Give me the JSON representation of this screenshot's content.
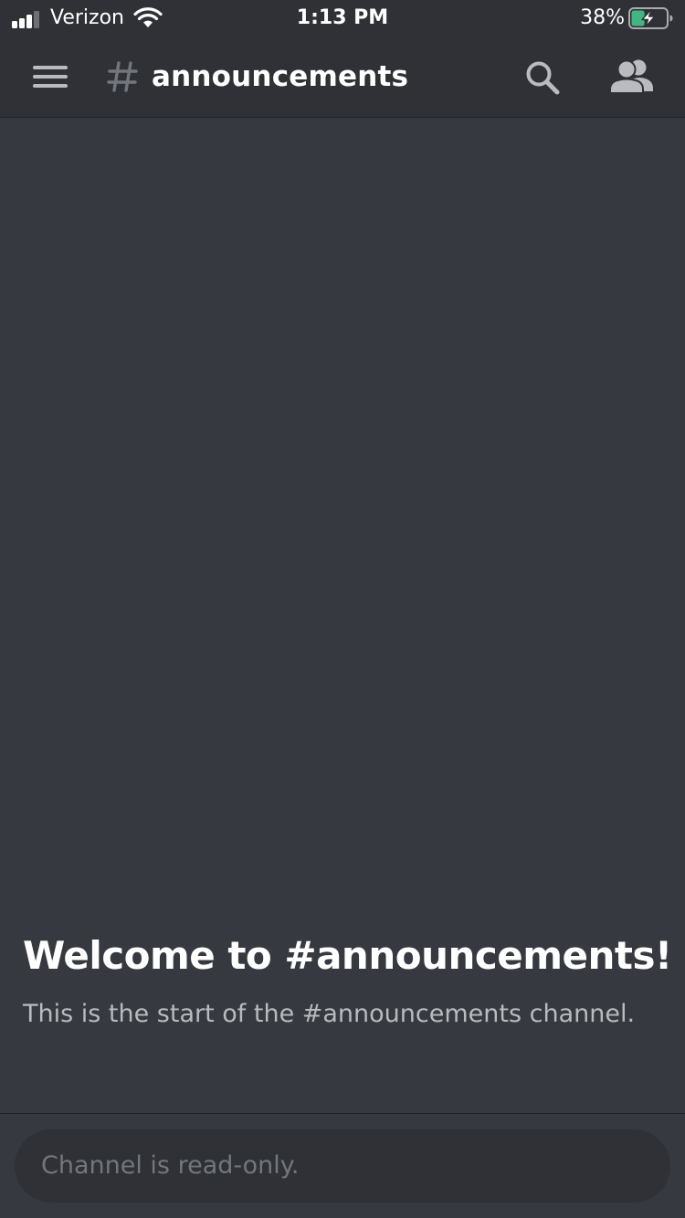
{
  "status_bar": {
    "carrier": "Verizon",
    "time": "1:13 PM",
    "battery_percent": "38%",
    "battery_level": 0.38,
    "battery_charging": true,
    "signal_bars": 3
  },
  "header": {
    "channel_name": "announcements",
    "icons": {
      "menu": "hamburger-menu-icon",
      "channel": "hash-icon",
      "search": "search-icon",
      "members": "members-icon"
    }
  },
  "welcome": {
    "title": "Welcome to #announcements!",
    "subtitle": "This is the start of the #announcements channel."
  },
  "composer": {
    "placeholder": "Channel is read-only."
  },
  "colors": {
    "background": "#36393f",
    "header_bg": "#2f3136",
    "text_primary": "#ffffff",
    "text_muted": "#b9bbbe",
    "placeholder": "#72767d",
    "battery_green": "#43b581"
  }
}
